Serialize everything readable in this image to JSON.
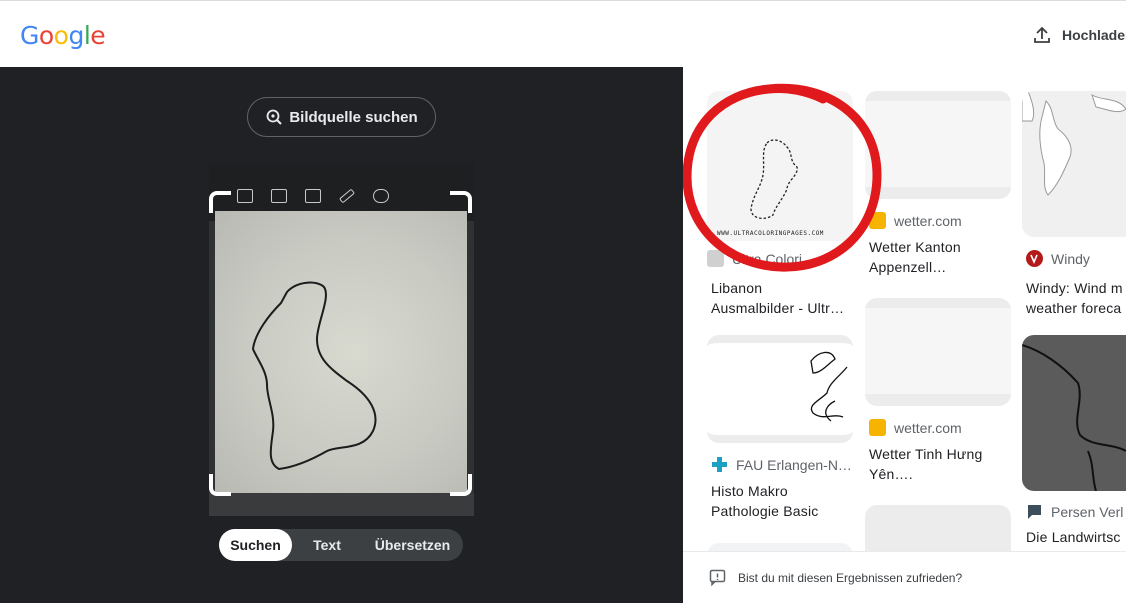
{
  "header": {
    "logo_letters": [
      "G",
      "o",
      "o",
      "g",
      "l",
      "e"
    ],
    "logo_colors": [
      "#4285F4",
      "#EA4335",
      "#FBBC05",
      "#4285F4",
      "#34A853",
      "#EA4335"
    ],
    "upload_label": "Hochladen",
    "upload_icon": "upload-icon"
  },
  "left_panel": {
    "source_button_label": "Bildquelle suchen",
    "source_button_icon": "lens-search-icon",
    "modes": [
      "Suchen",
      "Text",
      "Übersetzen"
    ],
    "active_mode": "Suchen"
  },
  "results": [
    {
      "source": "Ultra Colori…",
      "title_line1": "Libanon",
      "title_line2": "Ausmalbilder - Ultr…",
      "watermark": "WWW.ULTRACOLORINGPAGES.COM",
      "highlighted": true
    },
    {
      "source": "wetter.com",
      "title_line1": "Wetter Kanton",
      "title_line2": "Appenzell…"
    },
    {
      "source": "Windy",
      "title_line1": "Windy: Wind m",
      "title_line2": "weather foreca"
    },
    {
      "source": "FAU Erlangen-N…",
      "title_line1": "Histo Makro",
      "title_line2": "Pathologie Basic"
    },
    {
      "source": "wetter.com",
      "title_line1": "Wetter Tinh Hưng",
      "title_line2": "Yên…."
    },
    {
      "source": "Persen Verl",
      "title_line1": "Die Landwirtsc",
      "title_line2": ""
    }
  ],
  "feedback_text": "Bist du mit diesen Ergebnissen zufrieden?",
  "colors": {
    "dark_panel": "#202124",
    "highlight_circle": "#E0191C",
    "wetter_favicon": "#F6B400",
    "windy_favicon": "#B31B1B",
    "fau_favicon": "#1BA1C4",
    "persen_favicon": "#3C4E5C"
  }
}
